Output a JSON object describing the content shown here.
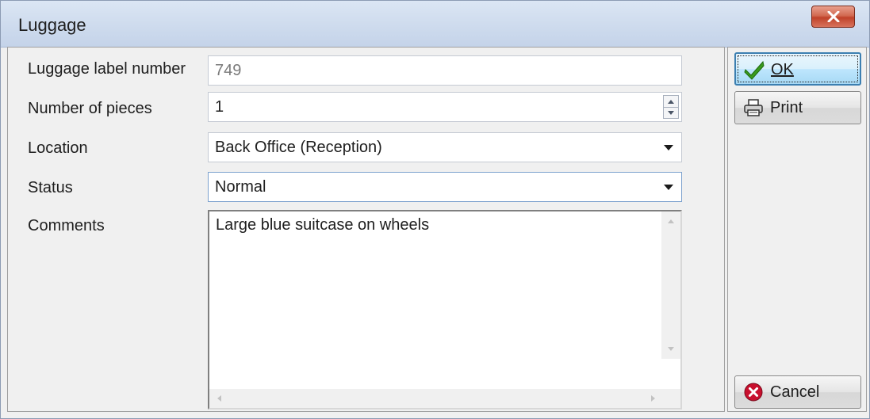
{
  "window": {
    "title": "Luggage"
  },
  "form": {
    "luggage_label": {
      "label": "Luggage label number",
      "value": "749"
    },
    "pieces": {
      "label": "Number of pieces",
      "value": "1"
    },
    "location": {
      "label": "Location",
      "value": "Back Office (Reception)"
    },
    "status": {
      "label": "Status",
      "value": "Normal"
    },
    "comments": {
      "label": "Comments",
      "value": "Large blue suitcase on wheels"
    }
  },
  "buttons": {
    "ok": "OK",
    "print": "Print",
    "cancel": "Cancel"
  },
  "icons": {
    "close": "close-icon",
    "ok": "checkmark-icon",
    "print": "printer-icon",
    "cancel": "cancel-icon"
  },
  "colors": {
    "title_bar": "#cfdcee",
    "close_button": "#c0422a",
    "default_button": "#bee6fd",
    "check_green": "#3a9a1d",
    "cancel_red": "#c8102e"
  }
}
